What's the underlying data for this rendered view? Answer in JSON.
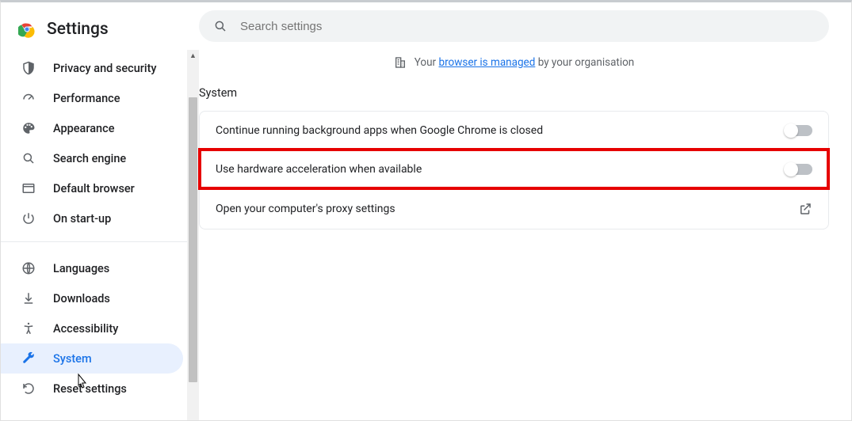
{
  "brand": {
    "title": "Settings"
  },
  "search": {
    "placeholder": "Search settings"
  },
  "banner": {
    "prefix": "Your ",
    "link": "browser is managed",
    "suffix": " by your organisation"
  },
  "section": {
    "title": "System"
  },
  "sidebar": {
    "group1": [
      {
        "label": "Privacy and security"
      },
      {
        "label": "Performance"
      },
      {
        "label": "Appearance"
      },
      {
        "label": "Search engine"
      },
      {
        "label": "Default browser"
      },
      {
        "label": "On start-up"
      }
    ],
    "group2": [
      {
        "label": "Languages"
      },
      {
        "label": "Downloads"
      },
      {
        "label": "Accessibility"
      },
      {
        "label": "System"
      },
      {
        "label": "Reset settings"
      }
    ]
  },
  "rows": {
    "bg_apps": "Continue running background apps when Google Chrome is closed",
    "hw_accel": "Use hardware acceleration when available",
    "proxy": "Open your computer's proxy settings"
  }
}
